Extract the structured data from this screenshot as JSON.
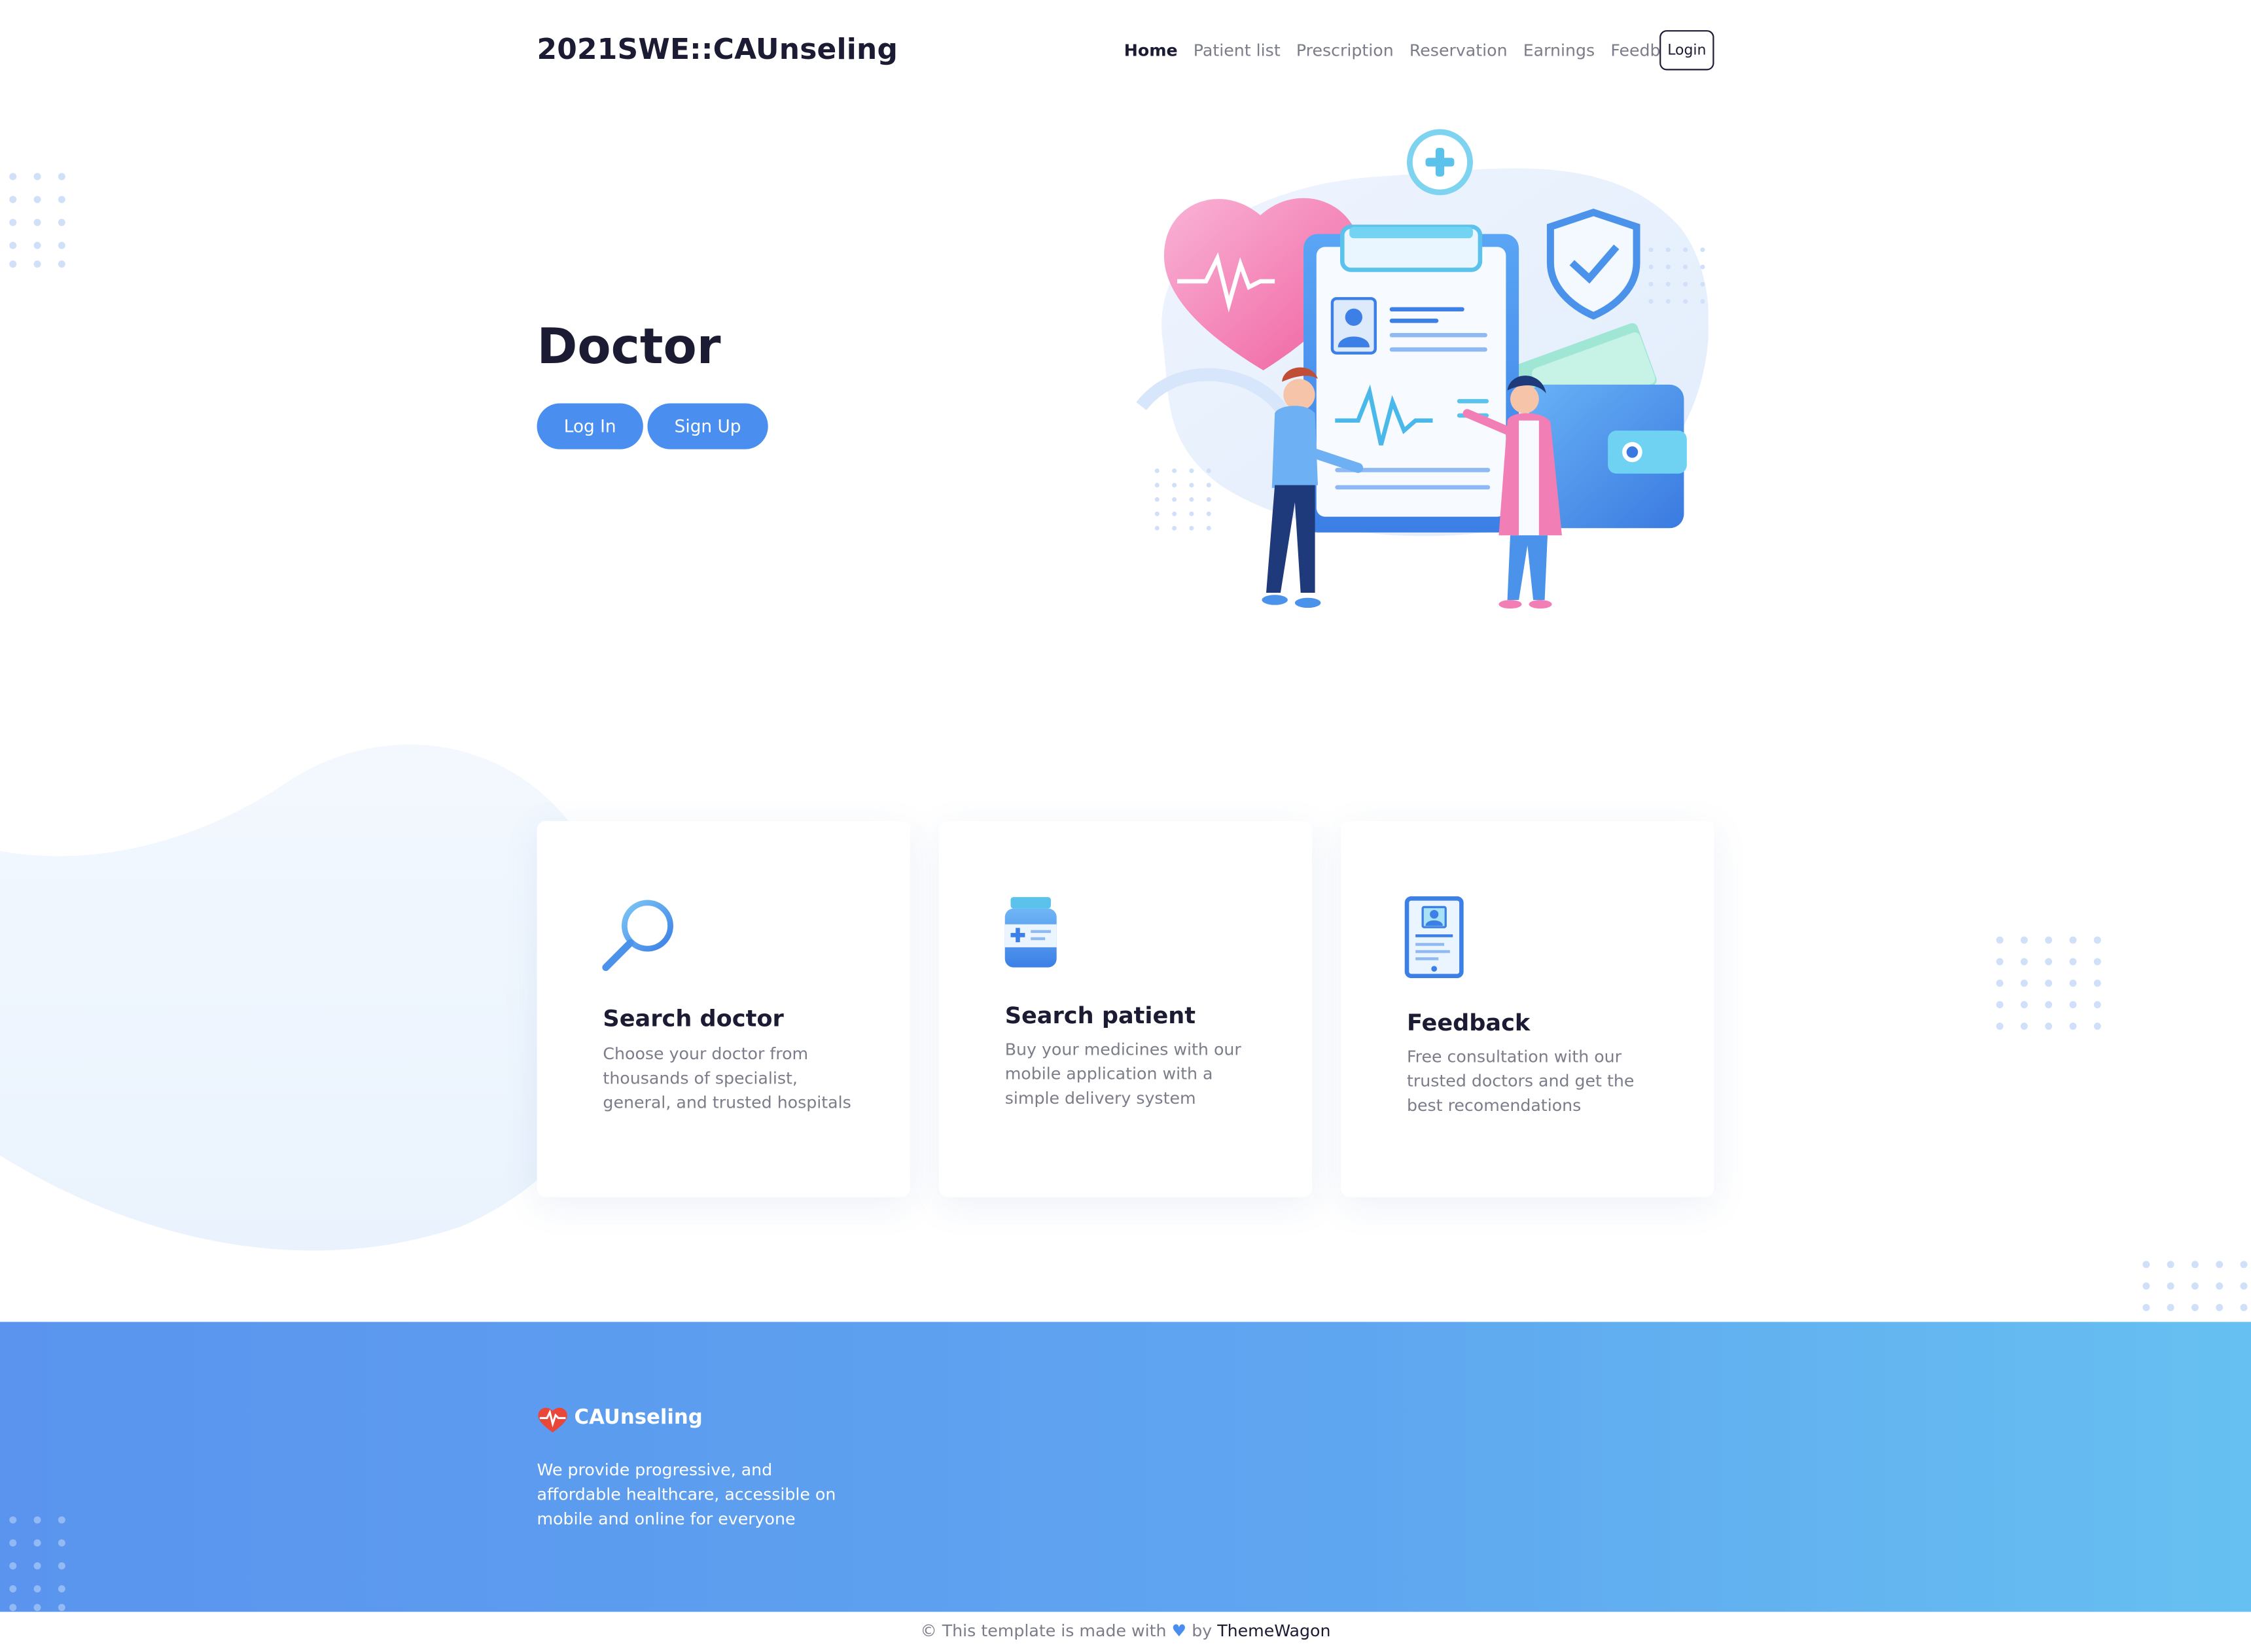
{
  "navbar": {
    "brand": "2021SWE::CAUnseling",
    "links": [
      {
        "label": "Home",
        "active": true
      },
      {
        "label": "Patient list",
        "active": false
      },
      {
        "label": "Prescription",
        "active": false
      },
      {
        "label": "Reservation",
        "active": false
      },
      {
        "label": "Earnings",
        "active": false
      },
      {
        "label": "Feedback",
        "active": false
      }
    ],
    "login_label": "Login"
  },
  "hero": {
    "title": "Doctor",
    "login_button": "Log In",
    "signup_button": "Sign Up",
    "illustration_icon": "doctor-clipboard-illustration"
  },
  "features": [
    {
      "icon": "magnifier-icon",
      "title": "Search doctor",
      "text": "Choose your doctor from thousands of specialist, general, and trusted hospitals"
    },
    {
      "icon": "medicine-bottle-icon",
      "title": "Search patient",
      "text": "Buy your medicines with our mobile application with a simple delivery system"
    },
    {
      "icon": "tablet-profile-icon",
      "title": "Feedback",
      "text": "Free consultation with our trusted doctors and get the best recomendations"
    }
  ],
  "footer": {
    "brand": "CAUnseling",
    "logo_icon": "heart-pulse-icon",
    "description": "We provide progressive, and affordable healthcare, accessible on mobile and online for everyone"
  },
  "copyright": {
    "prefix": "© This template is made with",
    "by": "by",
    "author": "ThemeWagon",
    "heart_icon": "heart-icon"
  },
  "colors": {
    "primary": "#4a8eef",
    "text_dark": "#1b1b33",
    "text_muted": "#7b7d8a",
    "footer_start": "#5a94ee",
    "footer_end": "#66c0f1"
  }
}
